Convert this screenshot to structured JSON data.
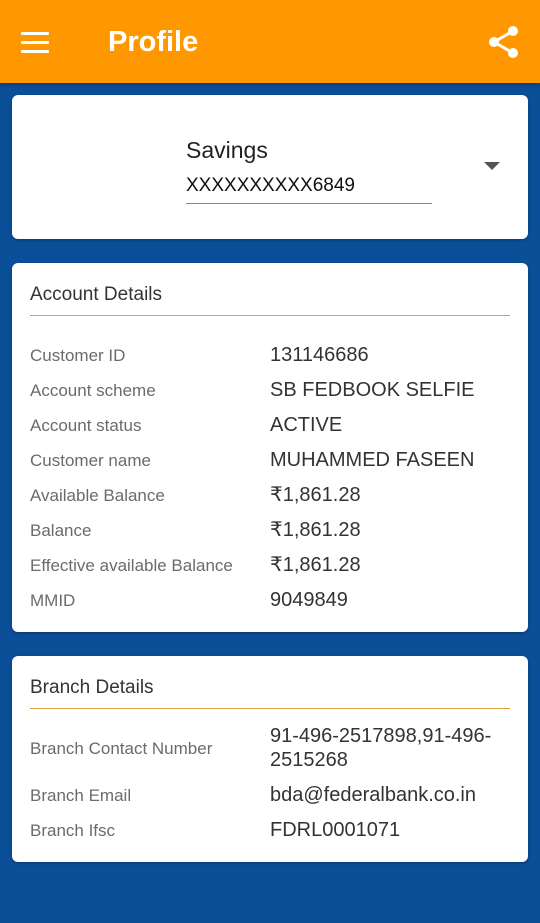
{
  "appbar": {
    "title": "Profile"
  },
  "account_select": {
    "account_type": "Savings",
    "account_number": "XXXXXXXXXX6849"
  },
  "account_details": {
    "title": "Account Details",
    "rows": [
      {
        "label": "Customer ID",
        "value": "131146686"
      },
      {
        "label": "Account scheme",
        "value": "SB FEDBOOK SELFIE"
      },
      {
        "label": "Account status",
        "value": "ACTIVE"
      },
      {
        "label": "Customer name",
        "value": "MUHAMMED FASEEN"
      },
      {
        "label": "Available Balance",
        "value": "₹1,861.28"
      },
      {
        "label": "Balance",
        "value": "₹1,861.28"
      },
      {
        "label": "Effective available Balance",
        "value": "₹1,861.28"
      },
      {
        "label": "MMID",
        "value": "9049849"
      }
    ]
  },
  "branch_details": {
    "title": "Branch Details",
    "rows": [
      {
        "label": "Branch Contact Number",
        "value": "91-496-2517898,91-496-2515268"
      },
      {
        "label": "Branch Email",
        "value": "bda@federalbank.co.in"
      },
      {
        "label": "Branch Ifsc",
        "value": "FDRL0001071"
      }
    ]
  },
  "colors": {
    "appbar": "#ff9800",
    "background": "#0b4f99",
    "accent_line": "#d9a441"
  }
}
